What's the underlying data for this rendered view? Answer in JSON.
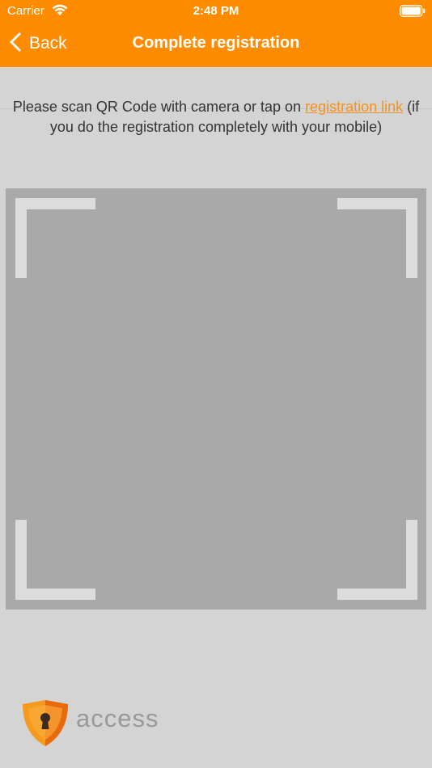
{
  "status_bar": {
    "carrier": "Carrier",
    "time": "2:48 PM"
  },
  "nav": {
    "back_label": "Back",
    "title": "Complete registration"
  },
  "instructions": {
    "line_start": "Please scan QR Code with camera or tap on ",
    "link_text": "registration link",
    "line_end": " (if you do the registration completely with your mobile)"
  },
  "footer": {
    "brand": "access"
  },
  "colors": {
    "header": "#ff8c00",
    "link": "#f5921e",
    "background": "#d4d4d4",
    "scanner_area": "#a9a9a9"
  }
}
